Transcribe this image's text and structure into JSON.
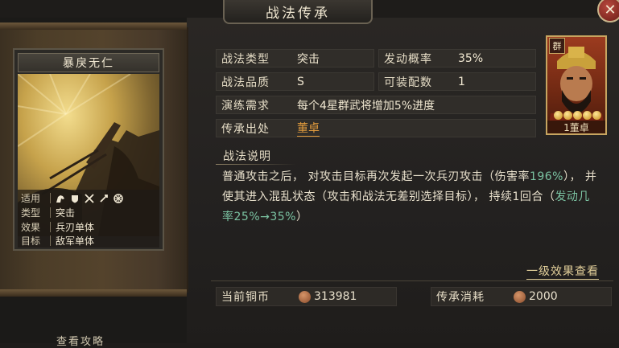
{
  "window": {
    "title": "战法传承",
    "close_icon": "✕"
  },
  "card": {
    "name": "暴戾无仁",
    "rows": [
      {
        "key": "适用",
        "value": ""
      },
      {
        "key": "类型",
        "value": "突击"
      },
      {
        "key": "效果",
        "value": "兵刃单体"
      },
      {
        "key": "目标",
        "value": "敌军单体"
      }
    ],
    "applicable_icons": [
      "cavalry-icon",
      "shield-icon",
      "crossed-swords-icon",
      "spear-icon",
      "crossbow-wheel-icon"
    ]
  },
  "attributes": {
    "type_label": "战法类型",
    "type_value": "突击",
    "quality_label": "战法品质",
    "quality_value": "S",
    "trigger_label": "发动概率",
    "trigger_value": "35%",
    "equip_label": "可装配数",
    "equip_value": "1",
    "train_label": "演练需求",
    "train_value": "每个4星群武将增加5%进度",
    "source_label": "传承出处",
    "source_value": "董卓"
  },
  "portrait": {
    "faction": "群",
    "stars": 5,
    "name": "1董卓"
  },
  "description": {
    "title": "战法说明",
    "part1": "普通攻击之后， 对攻击目标再次发起一次兵刃攻击（伤害率",
    "part2_green": "196%",
    "part3": "）， 并使其进入混乱状态（攻击和战法无差别选择目标）， 持续1回合（",
    "part4_green": "发动几率25%→35%",
    "part5": "）"
  },
  "effect_link": "一级效果查看",
  "footer": {
    "copper_label": "当前铜币",
    "copper_value": "313981",
    "cost_label": "传承消耗",
    "cost_value": "2000"
  },
  "bottom_hint": "查看攻略"
}
